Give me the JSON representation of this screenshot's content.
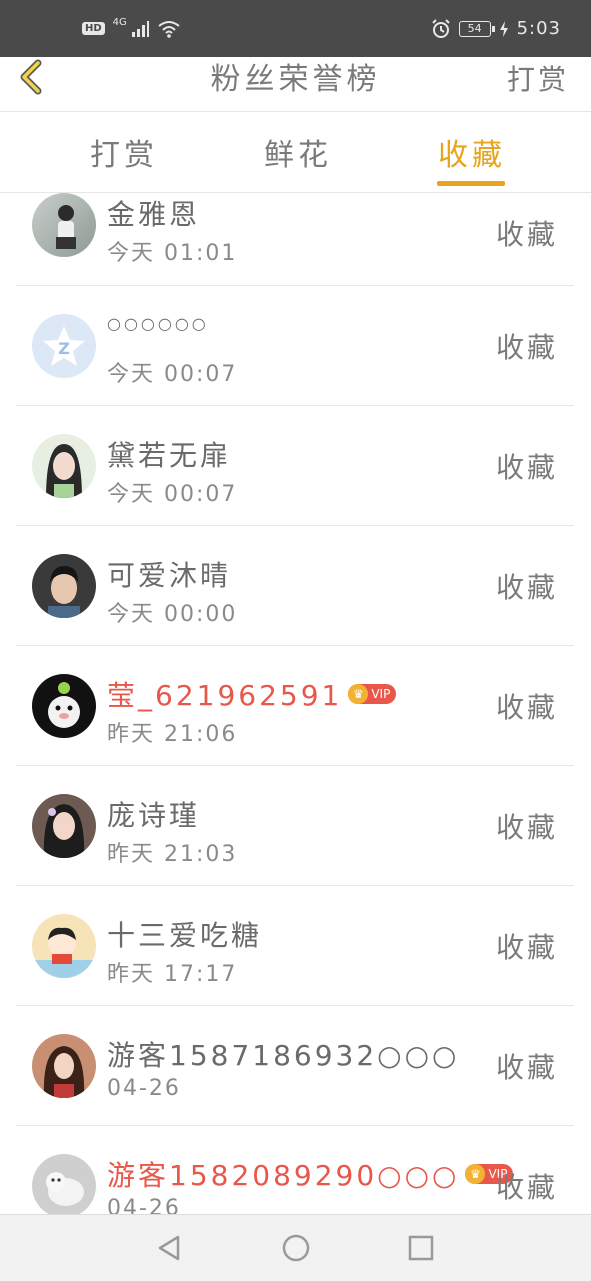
{
  "status_bar": {
    "hd": "HD",
    "network": "4G",
    "battery": "54",
    "time": "5:03",
    "icons": [
      "signal-icon",
      "wifi-icon",
      "alarm-icon",
      "charging-icon"
    ]
  },
  "header": {
    "title": "粉丝荣誉榜",
    "right_action": "打赏",
    "back_icon": "chevron-left-icon",
    "accent_color": "#e8a41c"
  },
  "tabs": [
    {
      "label": "打赏",
      "active": false
    },
    {
      "label": "鲜花",
      "active": false
    },
    {
      "label": "收藏",
      "active": true
    }
  ],
  "list": [
    {
      "name": "金雅恩",
      "time": "今天 01:01",
      "action": "收藏",
      "vip": false
    },
    {
      "name": "○○○○○○",
      "time": "今天 00:07",
      "action": "收藏",
      "vip": false
    },
    {
      "name": "黛若无扉",
      "time": "今天 00:07",
      "action": "收藏",
      "vip": false
    },
    {
      "name": "可爱沐晴",
      "time": "今天 00:00",
      "action": "收藏",
      "vip": false
    },
    {
      "name": "莹_621962591",
      "time": "昨天 21:06",
      "action": "收藏",
      "vip": true,
      "vip_label": "VIP"
    },
    {
      "name": "庞诗瑾",
      "time": "昨天 21:03",
      "action": "收藏",
      "vip": false
    },
    {
      "name": "十三爱吃糖",
      "time": "昨天 17:17",
      "action": "收藏",
      "vip": false
    },
    {
      "name": "游客1587186932○○○",
      "time": "04-26",
      "action": "收藏",
      "vip": false
    },
    {
      "name": "游客1582089290○○○",
      "time": "04-26",
      "action": "收藏",
      "vip": true,
      "vip_label": "VIP"
    }
  ],
  "nav_bar": {
    "icons": [
      "back-triangle-icon",
      "home-circle-icon",
      "recents-square-icon"
    ]
  }
}
